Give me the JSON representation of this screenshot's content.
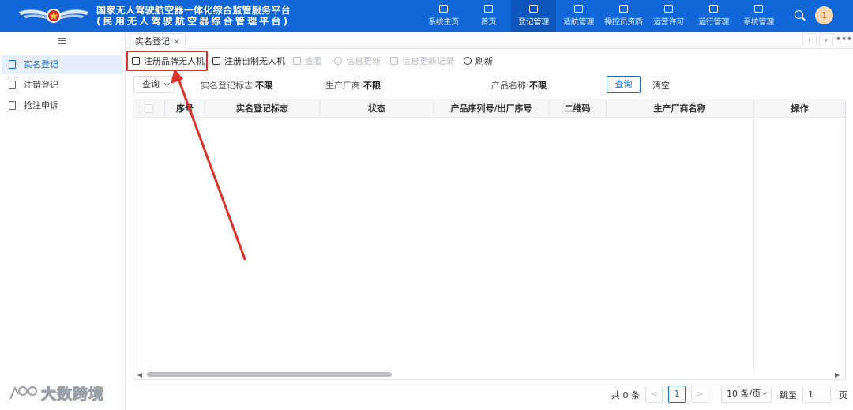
{
  "header": {
    "title_line1": "国家无人驾驶航空器一体化综合监管服务平台",
    "title_line2": "(民用无人驾驶航空器综合管理平台)",
    "nav": [
      {
        "label": "系统主页",
        "icon": "system-home-icon"
      },
      {
        "label": "首页",
        "icon": "monitor-icon"
      },
      {
        "label": "登记管理",
        "icon": "register-icon"
      },
      {
        "label": "适航管理",
        "icon": "drone-icon"
      },
      {
        "label": "操控员资质",
        "icon": "shield-icon"
      },
      {
        "label": "运营许可",
        "icon": "license-icon"
      },
      {
        "label": "运行管理",
        "icon": "clipboard-icon"
      },
      {
        "label": "系统管理",
        "icon": "settings-icon"
      }
    ],
    "active_nav": "登记管理",
    "avatar_text": "1"
  },
  "sidebar": {
    "items": [
      {
        "label": "实名登记",
        "icon": "register-doc-icon"
      },
      {
        "label": "注销登记",
        "icon": "cancel-doc-icon"
      },
      {
        "label": "抢注申诉",
        "icon": "appeal-doc-icon"
      }
    ]
  },
  "tabs": [
    {
      "label": "实名登记",
      "close": "×"
    }
  ],
  "toolbar": {
    "buttons": [
      {
        "label": "注册品牌无人机",
        "enabled": true
      },
      {
        "label": "注册自制无人机",
        "enabled": true
      },
      {
        "label": "查看",
        "enabled": false
      },
      {
        "label": "信息更新",
        "enabled": false
      },
      {
        "label": "信息更新记录",
        "enabled": false
      },
      {
        "label": "刷新",
        "enabled": true
      }
    ]
  },
  "filter": {
    "mode": "查询",
    "fields": [
      {
        "label": "实名登记标志:",
        "value": "不限"
      },
      {
        "label": "生产厂商:",
        "value": "不限"
      },
      {
        "label": "产品名称:",
        "value": "不限"
      }
    ],
    "query_button": "查询",
    "clear_button": "清空"
  },
  "table": {
    "columns": [
      "序号",
      "实名登记标志",
      "状态",
      "产品序列号/出厂序号",
      "二维码",
      "生产厂商名称",
      "操作"
    ],
    "rows": []
  },
  "pagination": {
    "total_text": "共 0 条",
    "prev": "<",
    "current_page": "1",
    "next": ">",
    "page_size": "10 条/页",
    "jump_label": "跳至",
    "jump_value": "1",
    "page_unit": "页"
  },
  "watermark": "大数跨境",
  "colors": {
    "header_bg": "#1166d8",
    "accent": "#1166d8",
    "annotation_red": "#e0302a"
  }
}
